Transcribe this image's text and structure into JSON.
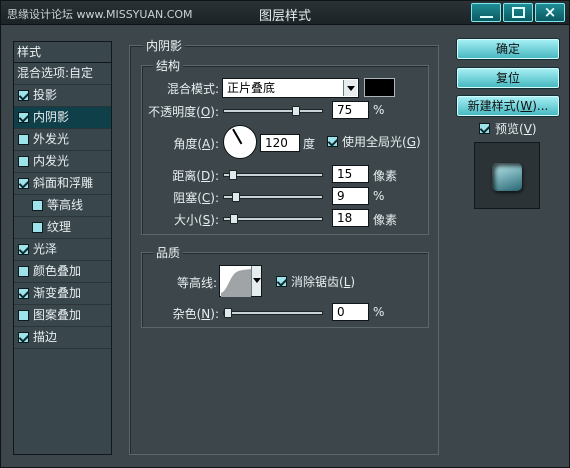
{
  "window": {
    "title": "图层样式",
    "watermark": "思缘设计论坛 www.MISSYUAN.COM"
  },
  "styles_list": {
    "header": "样式",
    "blend_options": "混合选项:自定",
    "items": [
      {
        "label": "投影",
        "checked": true,
        "selected": false,
        "sub": false
      },
      {
        "label": "内阴影",
        "checked": true,
        "selected": true,
        "sub": false
      },
      {
        "label": "外发光",
        "checked": false,
        "selected": false,
        "sub": false
      },
      {
        "label": "内发光",
        "checked": false,
        "selected": false,
        "sub": false
      },
      {
        "label": "斜面和浮雕",
        "checked": true,
        "selected": false,
        "sub": false
      },
      {
        "label": "等高线",
        "checked": false,
        "selected": false,
        "sub": true
      },
      {
        "label": "纹理",
        "checked": false,
        "selected": false,
        "sub": true
      },
      {
        "label": "光泽",
        "checked": true,
        "selected": false,
        "sub": false
      },
      {
        "label": "颜色叠加",
        "checked": false,
        "selected": false,
        "sub": false
      },
      {
        "label": "渐变叠加",
        "checked": true,
        "selected": false,
        "sub": false
      },
      {
        "label": "图案叠加",
        "checked": false,
        "selected": false,
        "sub": false
      },
      {
        "label": "描边",
        "checked": true,
        "selected": false,
        "sub": false
      }
    ]
  },
  "inner_shadow": {
    "section_title": "内阴影",
    "structure": {
      "title": "结构",
      "blend_mode_label": "混合模式:",
      "blend_mode_value": "正片叠底",
      "blend_color": "#000000",
      "opacity_label": "不透明度(",
      "opacity_key": "O",
      "opacity_value": "75",
      "opacity_unit": "%",
      "angle_label": "角度(",
      "angle_key": "A",
      "angle_value": "120",
      "angle_unit": "度",
      "global_light_label": "使用全局光(",
      "global_light_key": "G",
      "global_light_checked": true,
      "distance_label": "距离(",
      "distance_key": "D",
      "distance_value": "15",
      "distance_unit": "像素",
      "choke_label": "阻塞(",
      "choke_key": "C",
      "choke_value": "9",
      "choke_unit": "%",
      "size_label": "大小(",
      "size_key": "S",
      "size_value": "18",
      "size_unit": "像素"
    },
    "quality": {
      "title": "品质",
      "contour_label": "等高线:",
      "antialias_label": "消除锯齿(",
      "antialias_key": "L",
      "antialias_checked": true,
      "noise_label": "杂色(",
      "noise_key": "N",
      "noise_value": "0",
      "noise_unit": "%"
    }
  },
  "buttons": {
    "ok": "确定",
    "reset": "复位",
    "new_style_prefix": "新建样式(",
    "new_style_key": "W",
    "new_style_suffix": ")...",
    "preview_label_prefix": "预览(",
    "preview_key": "V",
    "preview_checked": true
  },
  "colors": {
    "accent": "#49b9c2",
    "selected_item": "#0f3f48",
    "panel_bg": "#3d474b"
  }
}
